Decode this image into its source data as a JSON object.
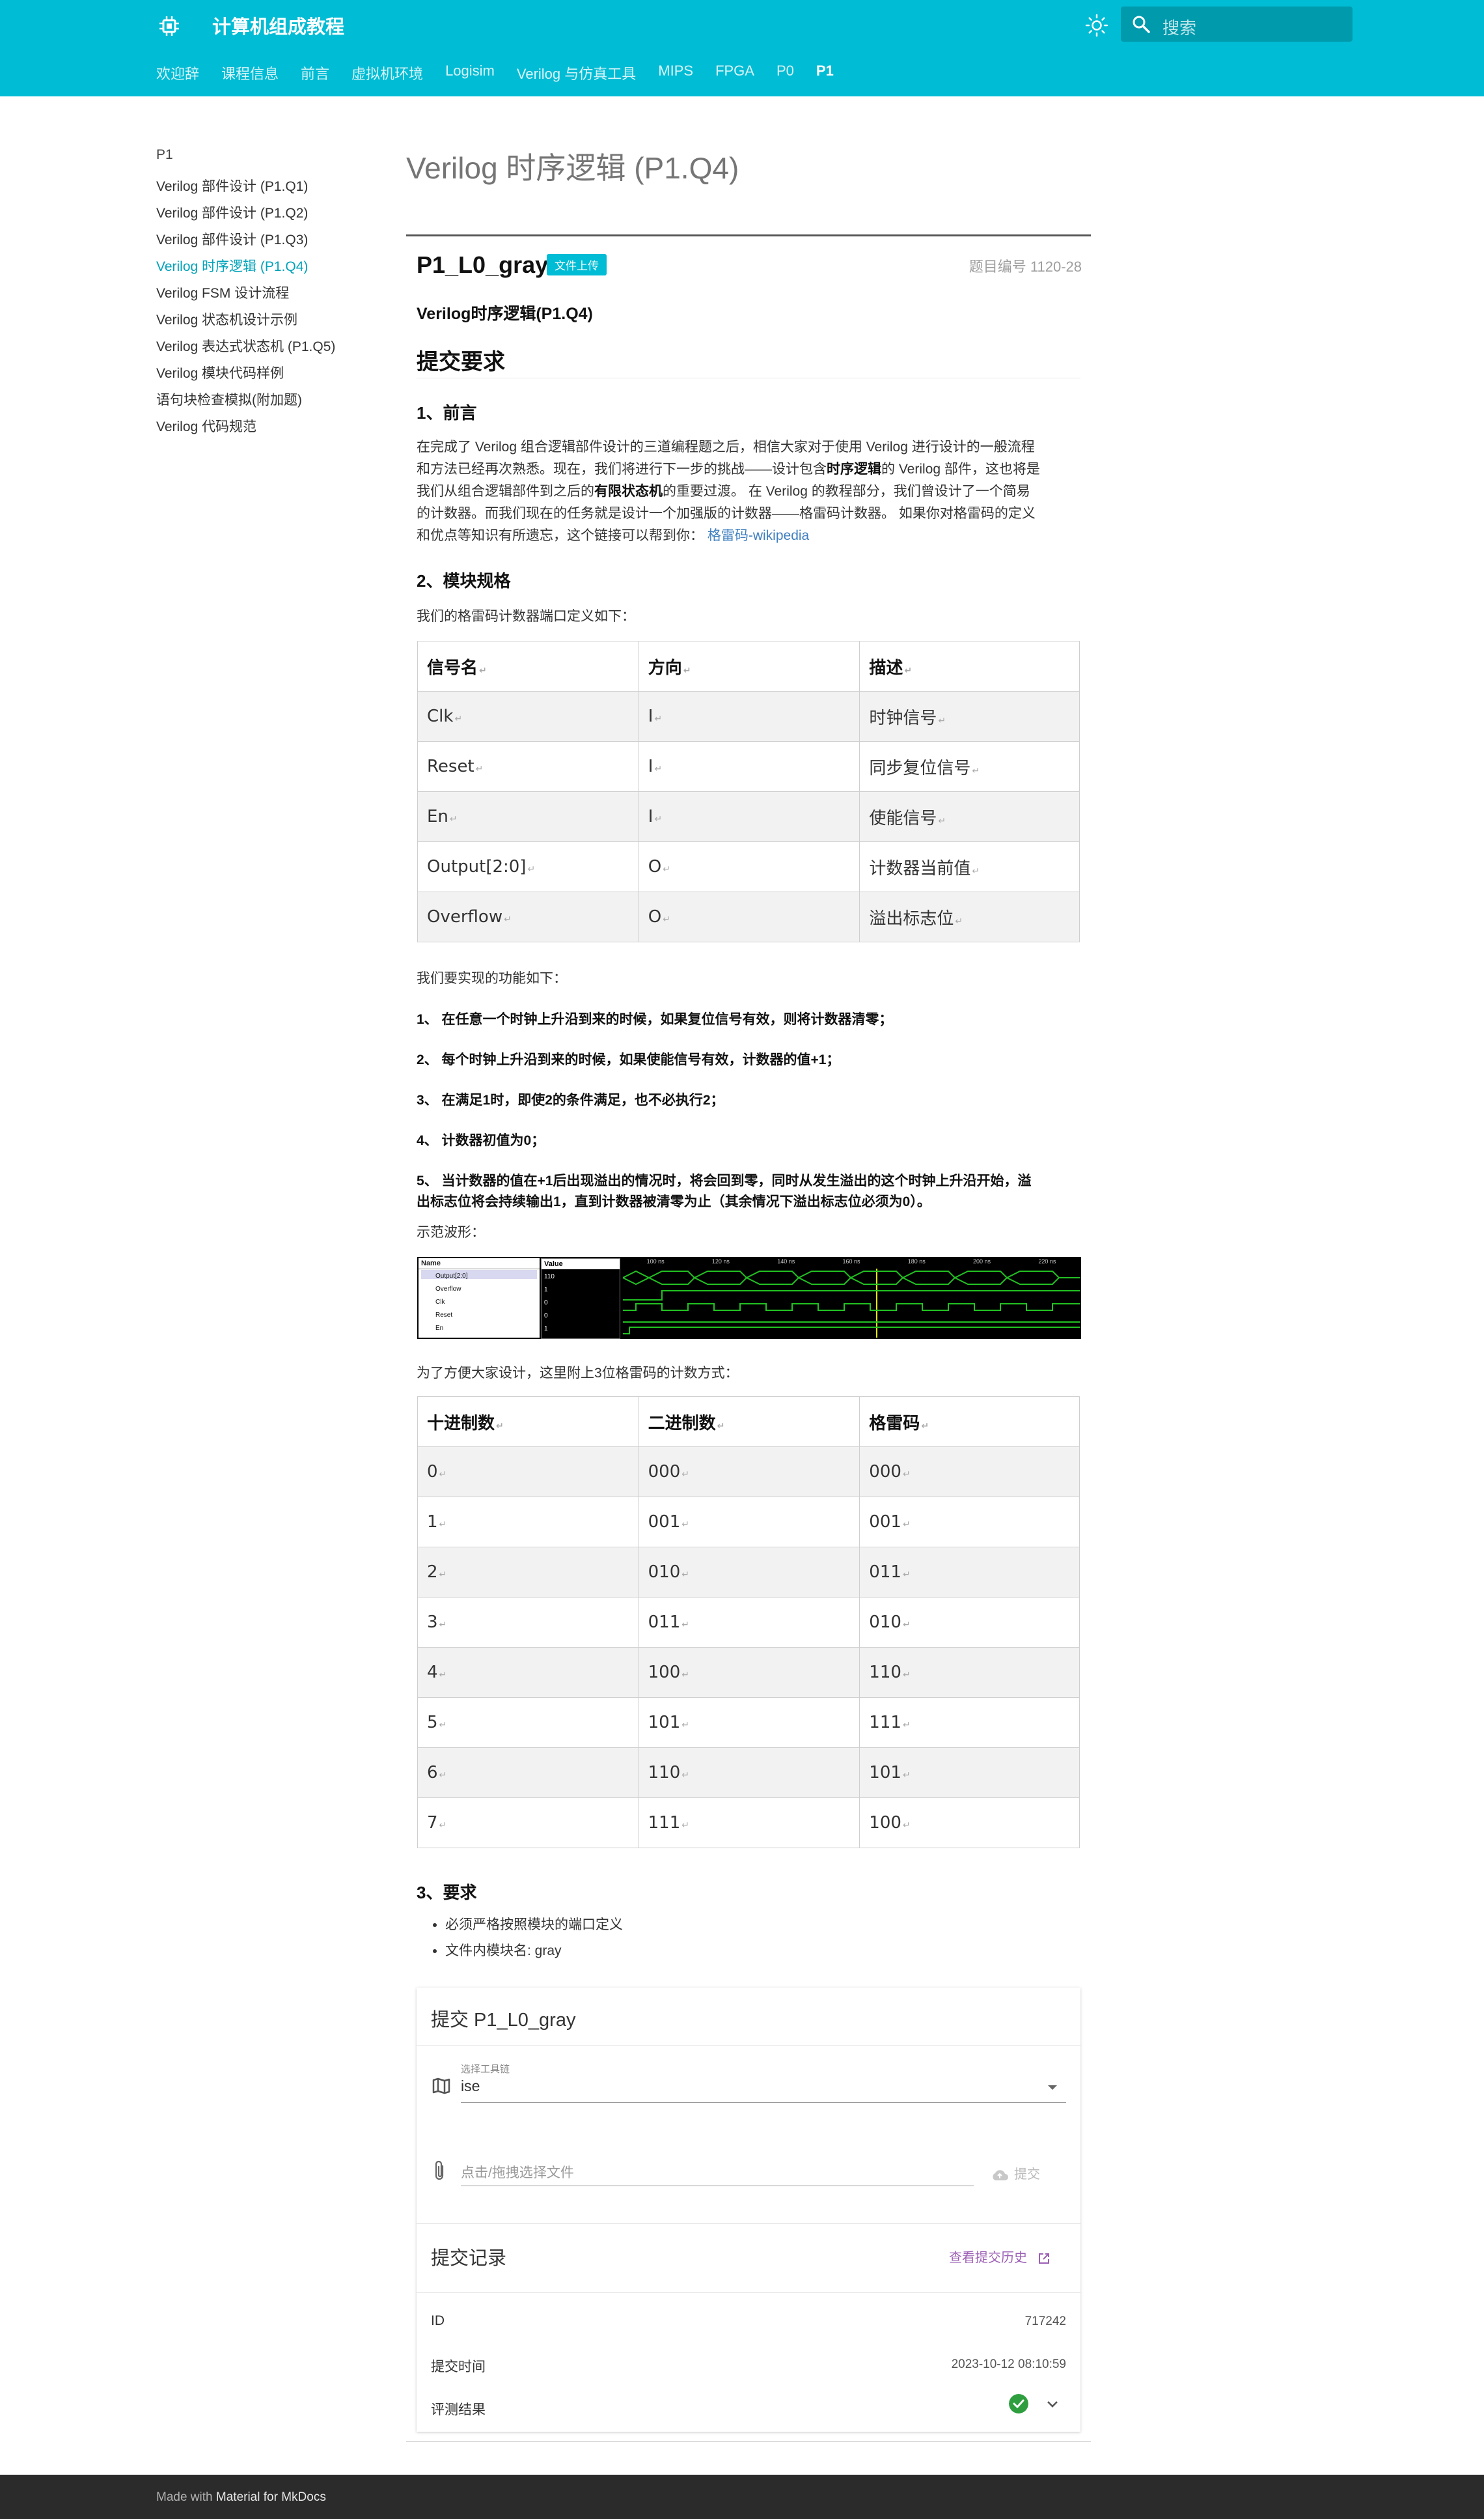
{
  "header": {
    "site_title": "计算机组成教程",
    "search_placeholder": "搜索",
    "tabs": [
      "欢迎辞",
      "课程信息",
      "前言",
      "虚拟机环境",
      "Logisim",
      "Verilog 与仿真工具",
      "MIPS",
      "FPGA",
      "P0",
      "P1"
    ],
    "active_tab": "P1",
    "brand_color": "#00bcd4"
  },
  "nav": {
    "title": "P1",
    "items": [
      "Verilog 部件设计 (P1.Q1)",
      "Verilog 部件设计 (P1.Q2)",
      "Verilog 部件设计 (P1.Q3)",
      "Verilog 时序逻辑 (P1.Q4)",
      "Verilog FSM 设计流程",
      "Verilog 状态机设计示例",
      "Verilog 表达式状态机 (P1.Q5)",
      "Verilog 模块代码样例",
      "语句块检查模拟(附加题)",
      "Verilog 代码规范"
    ],
    "active_item": "Verilog 时序逻辑 (P1.Q4)"
  },
  "page": {
    "h1": "Verilog 时序逻辑 (P1.Q4)",
    "problem_title": "P1_L0_gray",
    "badge": "文件上传",
    "problem_id": "题目编号 1120-28",
    "subtitle": "Verilog时序逻辑(P1.Q4)",
    "section_submit": "提交要求",
    "sec1_title": "1、前言",
    "sec1_p1": "在完成了 Verilog 组合逻辑部件设计的三道编程题之后，相信大家对于使用 Verilog 进行设计的一般流程",
    "sec1_p2": "和方法已经再次熟悉。现在，我们将进行下一步的挑战——设计包含",
    "sec1_b1": "时序逻辑",
    "sec1_p3": "的 Verilog 部件，这也将是",
    "sec1_p4": "我们从组合逻辑部件到之后的",
    "sec1_b2": "有限状态机",
    "sec1_p5": "的重要过渡。 在 Verilog 的教程部分，我们曾设计了一个简易",
    "sec1_p6": "的计数器。而我们现在的任务就是设计一个加强版的计数器——格雷码计数器。 如果你对格雷码的定义",
    "sec1_p7": "和优点等知识有所遗忘，这个链接可以帮到你：",
    "sec1_link": "格雷码-wikipedia",
    "sec2_title": "2、模块规格",
    "sec2_intro": "我们的格雷码计数器端口定义如下：",
    "ports_header": [
      "信号名",
      "方向",
      "描述"
    ],
    "ports_rows": [
      [
        "Clk",
        "I",
        "时钟信号"
      ],
      [
        "Reset",
        "I",
        "同步复位信号"
      ],
      [
        "En",
        "I",
        "使能信号"
      ],
      [
        "Output[2:0]",
        "O",
        "计数器当前值"
      ],
      [
        "Overflow",
        "O",
        "溢出标志位"
      ]
    ],
    "func_intro": "我们要实现的功能如下：",
    "req1": "1、 在任意一个时钟上升沿到来的时候，如果复位信号有效，则将计数器清零；",
    "req2": "2、 每个时钟上升沿到来的时候，如果使能信号有效，计数器的值+1；",
    "req3": "3、 在满足1时，即使2的条件满足，也不必执行2；",
    "req4": "4、 计数器初值为0；",
    "req5a": "5、 当计数器的值在+1后出现溢出的情况时，将会回到零，同时从发生溢出的这个时钟上升沿开始，溢",
    "req5b": "出标志位将会持续输出1，直到计数器被清零为止（其余情况下溢出标志位必须为0）。",
    "wave_label": "示范波形：",
    "wave": {
      "name_header": "Name",
      "value_header": "Value",
      "signals": [
        "Output[2:0]",
        "Overflow",
        "Clk",
        "Reset",
        "En"
      ],
      "values": [
        "110",
        "1",
        "0",
        "0",
        "1"
      ],
      "time_marks": [
        "100 ns",
        "120 ns",
        "140 ns",
        "160 ns",
        "180 ns",
        "200 ns",
        "220 ns"
      ]
    },
    "gray_intro": "为了方便大家设计，这里附上3位格雷码的计数方式：",
    "gray_header": [
      "十进制数",
      "二进制数",
      "格雷码"
    ],
    "gray_rows": [
      [
        "0",
        "000",
        "000"
      ],
      [
        "1",
        "001",
        "001"
      ],
      [
        "2",
        "010",
        "011"
      ],
      [
        "3",
        "011",
        "010"
      ],
      [
        "4",
        "100",
        "110"
      ],
      [
        "5",
        "101",
        "111"
      ],
      [
        "6",
        "110",
        "101"
      ],
      [
        "7",
        "111",
        "100"
      ]
    ],
    "sec3_title": "3、要求",
    "sec3_items": [
      "必须严格按照模块的端口定义",
      "文件内模块名: gray"
    ]
  },
  "submit": {
    "title": "提交 P1_L0_gray",
    "tool_label": "选择工具链",
    "tool_value": "ise",
    "file_placeholder": "点击/拖拽选择文件",
    "upload_label": "提交",
    "history_title": "提交记录",
    "history_link": "查看提交历史",
    "id_label": "ID",
    "id_value": "717242",
    "time_label": "提交时间",
    "time_value": "2023-10-12 08:10:59",
    "result_label": "评测结果",
    "result_color": "#2e9e3e"
  },
  "footer": {
    "prefix": "Made with",
    "link": "Material for MkDocs"
  }
}
